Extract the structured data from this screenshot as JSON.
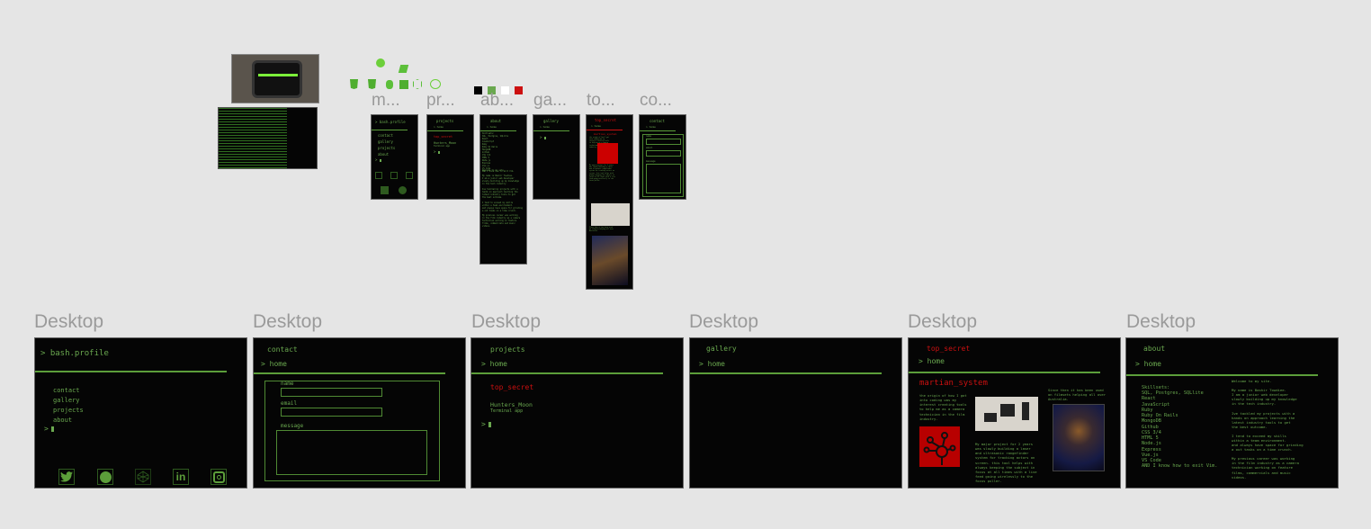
{
  "colors": {
    "green": "#6aa84f",
    "line": "#5c9e3a",
    "red": "#cc1010",
    "black": "#050505",
    "white": "#ffffff",
    "canvas": "#e5e5e5"
  },
  "swatches": [
    "#000000",
    "#6aa84f",
    "#ffffff",
    "#cc1010"
  ],
  "tech_icons": [
    "codepen-logo-icon",
    "gulp-icon",
    "css3-icon",
    "html5-icon",
    "sass-icon",
    "javascript-icon",
    "nodejs-icon",
    "react-icon"
  ],
  "mobile_labels": [
    "m...",
    "pr...",
    "ab...",
    "ga...",
    "to...",
    "co..."
  ],
  "desktop_label": "Desktop",
  "home": {
    "title": "> bash.profile",
    "menu": [
      "contact",
      "gallery",
      "projects",
      "about"
    ],
    "prompt": ">",
    "social": [
      "twitter-icon",
      "github-icon",
      "codepen-icon",
      "linkedin-icon",
      "instagram-icon"
    ]
  },
  "contact": {
    "title": "contact",
    "back": "> home",
    "name_label": "name",
    "email_label": "email",
    "message_label": "message"
  },
  "projects": {
    "title": "projects",
    "back": "> home",
    "section": "top_secret",
    "project_name": "Hunters_Moon",
    "project_desc": "Terminal app",
    "prompt": ">"
  },
  "gallery": {
    "title": "gallery",
    "back": "> home"
  },
  "top_secret": {
    "title": "top_secret",
    "back": "> home",
    "heading": "martian_system",
    "p1": "the origin of how I got\ninto coding was my\ninterest creating tools\nto help me as a camera\ntechnician in the film\nindustry.",
    "p2": "My major project for 2 years\nwas slowly building a laser\nand ultrasonic rangefinder\nsystem for tracking actors on\nscreen. this tool helps with\nalways keeping the subject in\nfocus at all times with a live\nfeed going wirelessly to the\nfocus puller.",
    "p3": "Since then it has been used\non filmsets helping all over\nAustralia."
  },
  "about": {
    "title": "about",
    "back": "> home",
    "skills": "Skillsets:\nSQL, Postgres, SQLlite\nReact\nJavaScript\nRuby\nRuby On Rails\nMongoDB\nGithub\nCSS 3/4\nHTML 5\nNode.js\nExpress\nVue.js\nVS Code\nAND I know how to exit Vim.",
    "bio": "Welcome to my site.\n\nMy name is Bashir Towdiee.\nI am a junior web developer\nslowly building up my knowledge\nin the tech industry.\n\nIve tackled my projects with a\nhands on approach learning the\nlatest industry tools to get\nthe best outcome.\n\nI tend to exceed my skills\nwithin a team environment.\nand always have space for grinding\na out tasks on a time crunch.\n\nMy previous career was working\nin the film industry as a camera\ntechnician working on feature\nfilms, commercials and music\nvideos."
  }
}
